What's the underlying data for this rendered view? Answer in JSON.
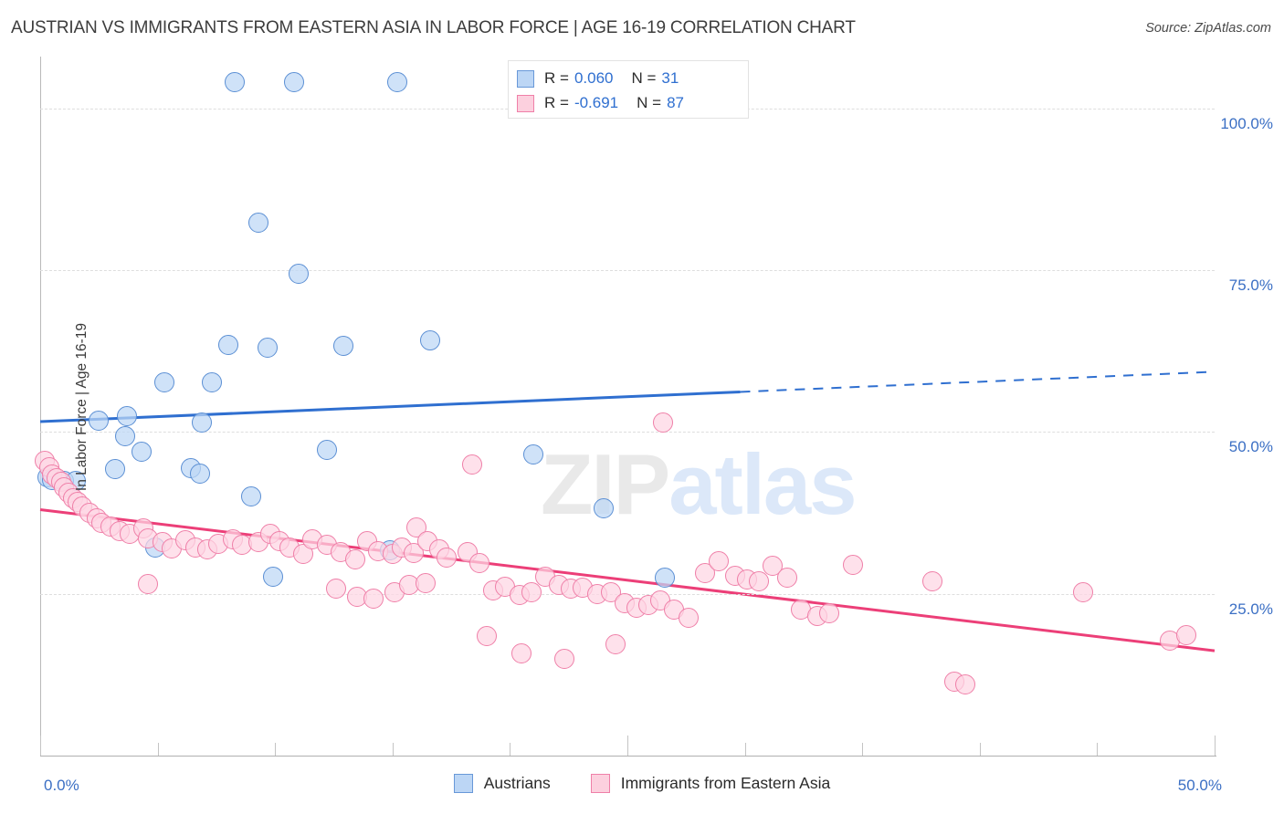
{
  "header": {
    "title": "AUSTRIAN VS IMMIGRANTS FROM EASTERN ASIA IN LABOR FORCE | AGE 16-19 CORRELATION CHART",
    "source": "Source: ZipAtlas.com"
  },
  "watermark": {
    "part1": "ZIP",
    "part2": "atlas"
  },
  "stats": {
    "blue": {
      "r_key": "R =",
      "r_value": "0.060",
      "n_key": "N =",
      "n_value": "31"
    },
    "pink": {
      "r_key": "R =",
      "r_value": "-0.691",
      "n_key": "N =",
      "n_value": "87"
    }
  },
  "legend": {
    "items": [
      {
        "label": "Austrians",
        "color": "#bcd6f5"
      },
      {
        "label": "Immigrants from Eastern Asia",
        "color": "#fcd0de"
      }
    ]
  },
  "chart_data": {
    "type": "scatter",
    "title": "AUSTRIAN VS IMMIGRANTS FROM EASTERN ASIA IN LABOR FORCE | AGE 16-19 CORRELATION CHART",
    "xlabel": "",
    "ylabel": "In Labor Force | Age 16-19",
    "xlim": [
      0,
      50
    ],
    "ylim": [
      0,
      108
    ],
    "x_ticks": [
      0,
      5,
      10,
      15,
      20,
      25,
      30,
      35,
      40,
      45,
      50
    ],
    "x_tick_labels": [
      "0.0%",
      "",
      "",
      "",
      "",
      "",
      "",
      "",
      "",
      "",
      "50.0%"
    ],
    "y_ticks": [
      25,
      50,
      75,
      100
    ],
    "y_tick_labels": [
      "25.0%",
      "50.0%",
      "75.0%",
      "100.0%"
    ],
    "grid": true,
    "legend_position": "bottom",
    "accent_blue": "#2f6fd0",
    "accent_pink": "#ec3f78",
    "series": [
      {
        "name": "Austrians",
        "color": "#bcd6f5",
        "edge": "#5b8fd4",
        "r": 0.06,
        "n": 31,
        "trend": {
          "x0": 0,
          "y0": 51.6,
          "x1": 50,
          "y1": 59.3,
          "solid_until_x": 29.8
        },
        "points": [
          [
            8.3,
            104.0
          ],
          [
            10.8,
            104.0
          ],
          [
            15.2,
            104.0
          ],
          [
            9.3,
            82.3
          ],
          [
            11.0,
            74.5
          ],
          [
            8.0,
            63.4
          ],
          [
            9.7,
            63.0
          ],
          [
            12.9,
            63.3
          ],
          [
            16.6,
            64.2
          ],
          [
            5.3,
            57.7
          ],
          [
            7.3,
            57.6
          ],
          [
            2.5,
            51.8
          ],
          [
            3.7,
            52.5
          ],
          [
            6.9,
            51.4
          ],
          [
            3.6,
            49.4
          ],
          [
            4.3,
            47.0
          ],
          [
            12.2,
            47.3
          ],
          [
            21.0,
            46.5
          ],
          [
            3.2,
            44.3
          ],
          [
            6.4,
            44.4
          ],
          [
            6.8,
            43.6
          ],
          [
            0.3,
            43.0
          ],
          [
            0.5,
            42.6
          ],
          [
            1.0,
            42.5
          ],
          [
            1.5,
            42.4
          ],
          [
            9.0,
            40.1
          ],
          [
            24.0,
            38.2
          ],
          [
            4.9,
            32.2
          ],
          [
            14.9,
            31.7
          ],
          [
            9.9,
            27.6
          ],
          [
            26.6,
            27.5
          ]
        ]
      },
      {
        "name": "Immigrants from Eastern Asia",
        "color": "#fcd0de",
        "edge": "#ef7fa8",
        "r": -0.691,
        "n": 87,
        "trend": {
          "x0": 0,
          "y0": 38.0,
          "x1": 50,
          "y1": 16.2,
          "solid_until_x": 50
        },
        "points": [
          [
            0.2,
            45.5
          ],
          [
            0.4,
            44.6
          ],
          [
            0.5,
            43.4
          ],
          [
            0.7,
            42.9
          ],
          [
            0.9,
            42.3
          ],
          [
            1.0,
            41.4
          ],
          [
            1.2,
            40.6
          ],
          [
            1.4,
            39.8
          ],
          [
            1.6,
            39.2
          ],
          [
            1.8,
            38.5
          ],
          [
            2.1,
            37.5
          ],
          [
            2.4,
            36.6
          ],
          [
            2.6,
            35.9
          ],
          [
            3.0,
            35.4
          ],
          [
            3.4,
            34.7
          ],
          [
            3.8,
            34.2
          ],
          [
            4.4,
            35.1
          ],
          [
            4.6,
            33.6
          ],
          [
            5.2,
            33.0
          ],
          [
            5.6,
            32.0
          ],
          [
            6.2,
            33.3
          ],
          [
            6.6,
            32.2
          ],
          [
            7.1,
            31.9
          ],
          [
            7.6,
            32.7
          ],
          [
            8.2,
            33.4
          ],
          [
            8.6,
            32.6
          ],
          [
            9.3,
            33.0
          ],
          [
            9.8,
            34.2
          ],
          [
            10.2,
            33.1
          ],
          [
            10.6,
            32.2
          ],
          [
            11.2,
            31.2
          ],
          [
            11.6,
            33.4
          ],
          [
            12.2,
            32.6
          ],
          [
            12.8,
            31.4
          ],
          [
            13.4,
            30.3
          ],
          [
            13.9,
            33.1
          ],
          [
            14.4,
            31.6
          ],
          [
            15.0,
            31.1
          ],
          [
            15.4,
            32.1
          ],
          [
            15.9,
            31.3
          ],
          [
            16.0,
            35.3
          ],
          [
            16.5,
            33.2
          ],
          [
            17.0,
            31.9
          ],
          [
            4.6,
            26.5
          ],
          [
            12.6,
            25.8
          ],
          [
            13.5,
            24.5
          ],
          [
            14.2,
            24.3
          ],
          [
            15.1,
            25.3
          ],
          [
            15.7,
            26.3
          ],
          [
            16.4,
            26.7
          ],
          [
            17.3,
            30.6
          ],
          [
            18.2,
            31.4
          ],
          [
            18.7,
            29.7
          ],
          [
            19.3,
            25.5
          ],
          [
            19.8,
            26.1
          ],
          [
            20.4,
            24.8
          ],
          [
            20.9,
            25.2
          ],
          [
            21.5,
            27.6
          ],
          [
            22.1,
            26.3
          ],
          [
            22.6,
            25.8
          ],
          [
            23.1,
            26.0
          ],
          [
            23.7,
            24.9
          ],
          [
            24.3,
            25.3
          ],
          [
            24.9,
            23.5
          ],
          [
            25.4,
            22.9
          ],
          [
            25.9,
            23.2
          ],
          [
            26.4,
            24.0
          ],
          [
            27.0,
            22.5
          ],
          [
            27.6,
            21.3
          ],
          [
            18.4,
            45.0
          ],
          [
            26.5,
            51.5
          ],
          [
            28.3,
            28.2
          ],
          [
            28.9,
            30.1
          ],
          [
            29.6,
            27.8
          ],
          [
            30.1,
            27.2
          ],
          [
            30.6,
            26.9
          ],
          [
            31.2,
            29.3
          ],
          [
            31.8,
            27.5
          ],
          [
            32.4,
            22.6
          ],
          [
            33.1,
            21.6
          ],
          [
            33.6,
            22.0
          ],
          [
            34.6,
            29.4
          ],
          [
            19.0,
            18.5
          ],
          [
            20.5,
            15.8
          ],
          [
            22.3,
            14.9
          ],
          [
            24.5,
            17.2
          ],
          [
            38.0,
            27.0
          ],
          [
            38.9,
            11.4
          ],
          [
            39.4,
            11.0
          ],
          [
            44.4,
            25.2
          ],
          [
            48.1,
            17.8
          ],
          [
            48.8,
            18.6
          ]
        ]
      }
    ]
  }
}
